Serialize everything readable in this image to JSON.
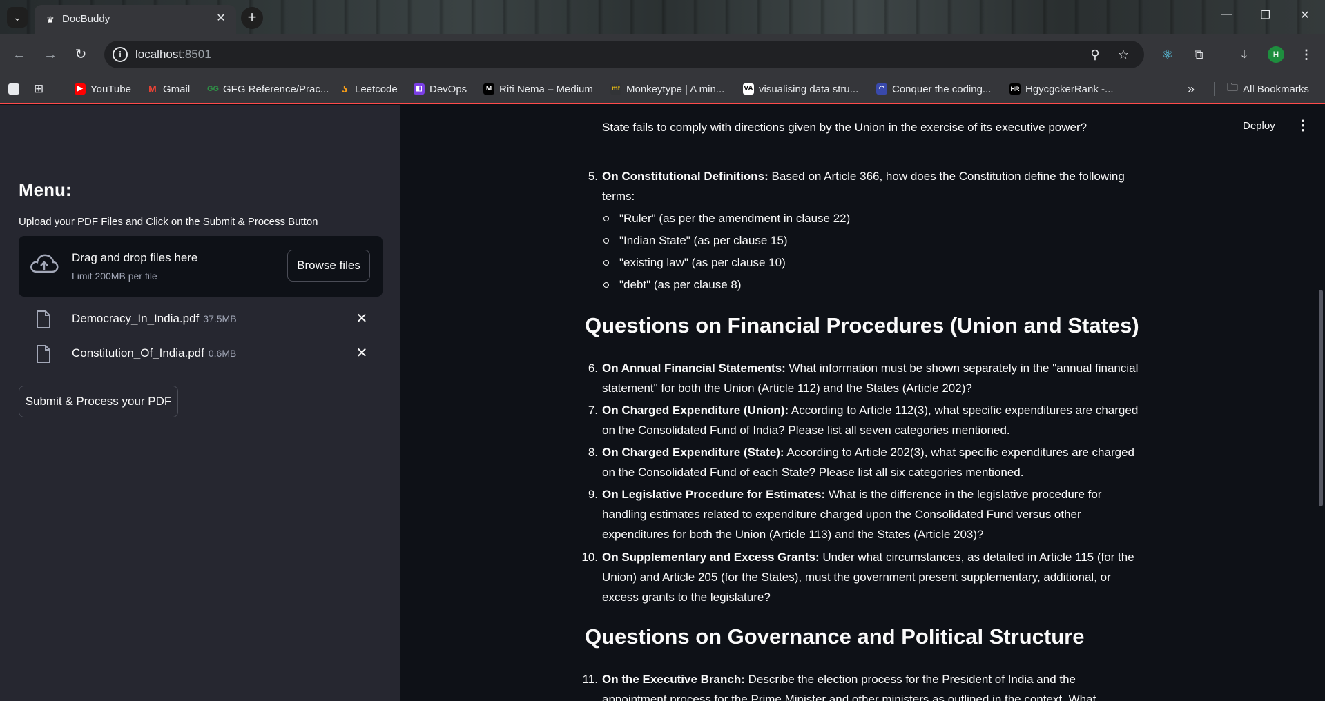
{
  "browser": {
    "tab_title": "DocBuddy",
    "url_host": "localhost",
    "url_port": ":8501",
    "bookmarks": [
      {
        "label": "YouTube",
        "icon": "youtube-icon",
        "color": "#ff0000"
      },
      {
        "label": "Gmail",
        "icon": "gmail-icon",
        "color": "#ea4335"
      },
      {
        "label": "GFG Reference/Prac...",
        "icon": "gfg-icon",
        "color": "#2f8d46"
      },
      {
        "label": "Leetcode",
        "icon": "leetcode-icon",
        "color": "#ffa116"
      },
      {
        "label": "DevOps",
        "icon": "devops-icon",
        "color": "#7b3fe4"
      },
      {
        "label": "Riti Nema – Medium",
        "icon": "medium-icon",
        "color": "#000000"
      },
      {
        "label": "Monkeytype | A min...",
        "icon": "monkeytype-icon",
        "color": "#e2b714"
      },
      {
        "label": "visualising data stru...",
        "icon": "visualgo-icon",
        "color": "#000000"
      },
      {
        "label": "Conquer the coding...",
        "icon": "codechef-icon",
        "color": "#5b4638"
      },
      {
        "label": "HgycgckerRank -...",
        "icon": "hackerrank-icon",
        "color": "#000000"
      }
    ],
    "all_bookmarks": "All Bookmarks",
    "profile_initial": "H"
  },
  "sidebar": {
    "menu_title": "Menu:",
    "upload_label": "Upload your PDF Files and Click on the Submit & Process Button",
    "dropzone_title": "Drag and drop files here",
    "dropzone_limit": "Limit 200MB per file",
    "browse_label": "Browse files",
    "files": [
      {
        "name": "Democracy_In_India.pdf",
        "size": "37.5MB"
      },
      {
        "name": "Constitution_Of_India.pdf",
        "size": "0.6MB"
      }
    ],
    "submit_label": "Submit & Process your PDF"
  },
  "header": {
    "deploy_label": "Deploy"
  },
  "content": {
    "top_line": "State fails to comply with directions given by the Union in the exercise of its executive power?",
    "q5": {
      "num": "5.",
      "bold": "On Constitutional Definitions:",
      "text_line1": " Based on Article 366, how does the Constitution define the following",
      "text_line2": "terms:",
      "subitems": [
        "\"Ruler\" (as per the amendment in clause 22)",
        "\"Indian State\" (as per clause 15)",
        "\"existing law\" (as per clause 10)",
        "\"debt\" (as per clause 8)"
      ]
    },
    "heading_financial": "Questions on Financial Procedures (Union and States)",
    "financial_questions": [
      {
        "num": "6.",
        "bold": "On Annual Financial Statements:",
        "line1": " What information must be shown separately in the \"annual financial",
        "line2": "statement\" for both the Union (Article 112) and the States (Article 202)?",
        "line3": ""
      },
      {
        "num": "7.",
        "bold": "On Charged Expenditure (Union):",
        "line1": " According to Article 112(3), what specific expenditures are charged",
        "line2": "on the Consolidated Fund of India? Please list all seven categories mentioned.",
        "line3": ""
      },
      {
        "num": "8.",
        "bold": "On Charged Expenditure (State):",
        "line1": " According to Article 202(3), what specific expenditures are charged",
        "line2": "on the Consolidated Fund of each State? Please list all six categories mentioned.",
        "line3": ""
      },
      {
        "num": "9.",
        "bold": "On Legislative Procedure for Estimates:",
        "line1": " What is the difference in the legislative procedure for",
        "line2": "handling estimates related to expenditure charged upon the Consolidated Fund versus other",
        "line3": "expenditures for both the Union (Article 113) and the States (Article 203)?"
      },
      {
        "num": "10.",
        "bold": "On Supplementary and Excess Grants:",
        "line1": " Under what circumstances, as detailed in Article 115 (for the",
        "line2": "Union) and Article 205 (for the States), must the government present supplementary, additional, or",
        "line3": "excess grants to the legislature?"
      }
    ],
    "heading_governance": "Questions on Governance and Political Structure",
    "q11": {
      "num": "11.",
      "bold": "On the Executive Branch:",
      "line1": " Describe the election process for the President of India and the",
      "line2": "appointment process for the Prime Minister and other ministers as outlined in the context. What"
    }
  }
}
